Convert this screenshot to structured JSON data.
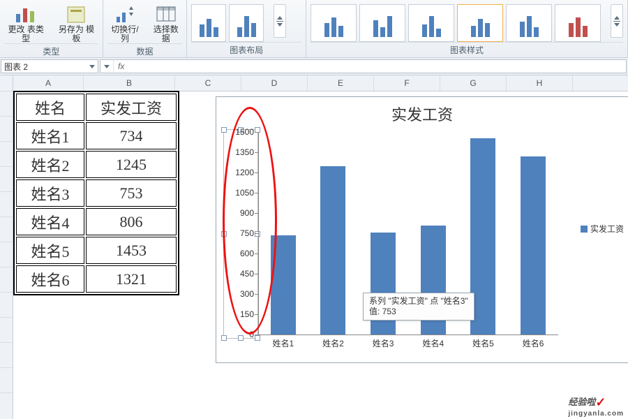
{
  "ribbon": {
    "g_type": {
      "title": "类型",
      "btn1": "更改\n表类型",
      "btn2": "另存为\n模板"
    },
    "g_data": {
      "title": "数据",
      "btn1": "切换行/列",
      "btn2": "选择数据"
    },
    "g_layout": {
      "title": "图表布局"
    },
    "g_style": {
      "title": "图表样式"
    }
  },
  "fbar": {
    "name": "图表 2",
    "fx_label": "fx"
  },
  "cols": [
    "A",
    "B",
    "C",
    "D",
    "E",
    "F",
    "G",
    "H"
  ],
  "table": {
    "head": [
      "姓名",
      "实发工资"
    ],
    "rows": [
      [
        "姓名1",
        "734"
      ],
      [
        "姓名2",
        "1245"
      ],
      [
        "姓名3",
        "753"
      ],
      [
        "姓名4",
        "806"
      ],
      [
        "姓名5",
        "1453"
      ],
      [
        "姓名6",
        "1321"
      ]
    ]
  },
  "chart_data": {
    "type": "bar",
    "title": "实发工资",
    "categories": [
      "姓名1",
      "姓名2",
      "姓名3",
      "姓名4",
      "姓名5",
      "姓名6"
    ],
    "values": [
      734,
      1245,
      753,
      806,
      1453,
      1321
    ],
    "series_name": "实发工资",
    "ylim": [
      0,
      1500
    ],
    "ystep": 150,
    "yticks": [
      0,
      150,
      300,
      450,
      600,
      750,
      900,
      1050,
      1200,
      1350,
      1500
    ],
    "xlabel": "",
    "ylabel": "",
    "legend": "实发工资"
  },
  "tooltip": {
    "line1": "系列 \"实发工资\" 点 \"姓名3\"",
    "line2": "值: 753"
  },
  "watermark": {
    "brand": "经验啦",
    "url": "jingyanla.com"
  }
}
